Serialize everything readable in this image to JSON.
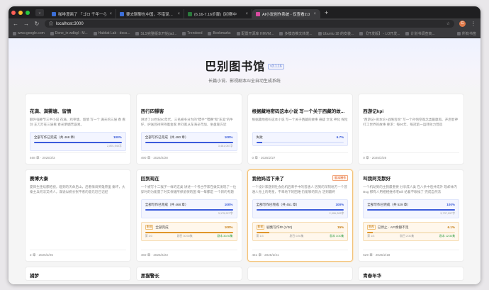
{
  "browser": {
    "tabs": [
      {
        "title": "咖啡漫画了 「ゴロ 千年一ら",
        "color": "#3c6fd8",
        "active": false
      },
      {
        "title": "要去聊聊也中国，不错误出(2)",
        "color": "#3c6fd8",
        "active": false
      },
      {
        "title": "(6.16-7.16步骤)【初赛中",
        "color": "#2b7a3c",
        "active": false
      },
      {
        "title": "AI小说创作系统 - 仅查看2.0",
        "color": "#d94ba0",
        "active": true
      }
    ],
    "url": "localhost:3000",
    "avatar_letter": "G",
    "bookmarks": [
      "www.google.com",
      "Done_in wdbgl - M...",
      "Habitat Lab - docs...",
      "SLS完整版本开始(ad...",
      "Trendeed",
      "Bookmarks",
      "配置开源库 HMVM...",
      "多模态推文转发...",
      "Ubuntu 18 的安装...",
      "【开发版】 - LO开发...",
      "计划书调查高..."
    ],
    "bookmarks_right": "所有书签"
  },
  "hero": {
    "title": "巴别图书馆",
    "version": "v3.1.16",
    "subtitle": "长篇小说、影视剧本AI全自动生成系统"
  },
  "rows": [
    [
      {
        "title": "花满、满雾塘、留情",
        "desc": "额外强要节三半小说 花满、鸡宰塘、留情 写一个 满天的三层 春 看 剑 王刀万在三层看 春光明媚芳容易。",
        "progress_label": "全部写作已完成（共 468 章）",
        "progress_pct": 100,
        "progress_pct_text": "100%",
        "words": "2,891,940字",
        "footer": "468 章 · 2025/3/3",
        "highlight": false
      },
      {
        "title": "西行四镖客",
        "desc": "讲述了19世纪60年代，三名被冬分为的\"镖手\"\"镖赛\"和\"东美\"的牛仔，护送吕祥突持着金家 奉刘家从车海辛市加、坐盘靠方近",
        "progress_label": "全部写作已完成（共 490 章）",
        "progress_pct": 100,
        "progress_pct_text": "100%",
        "words": "3,481,087字",
        "footer": "490 章 · 2025/2/28",
        "highlight": false
      },
      {
        "title": "根据藏地密码这本小说 写一个关于西藏的故...",
        "desc": "根据藏地密码这本小说 写一个关于西藏的故事 悬疑 文化 神化 探险",
        "progress_label": "失败",
        "progress_pct": 6.7,
        "progress_pct_text": "6.7%",
        "words": "",
        "footer": "0 章 · 2025/2/27",
        "highlight": false
      },
      {
        "title": "西游记kpi",
        "desc": "\"西游记+资本论+战略咨询\" 写一个孙悟空观念类最康再、开启智神打工世界的故事 要求：每90年、每冠第一运转效力营造",
        "progress_label": "",
        "progress_pct": 0,
        "progress_pct_text": "",
        "words": "",
        "footer": "0 章 · 2025/2/26",
        "highlight": false
      }
    ],
    [
      {
        "title": "赛博大秦",
        "desc": "夏目生连续都拓视，临到的天命启山，后看情调英雄原里 秦坏，大秦主兵何法又终人，谋诡似帆长张平者的意元近已记纪",
        "progress_label": "",
        "progress_pct": 0,
        "progress_pct_text": "",
        "words": "",
        "footer": "2 章 · 2025/2/25",
        "highlight": false,
        "overlay": null
      },
      {
        "title": "回到现在",
        "desc": "一个被写十二猴子一样的这类 讲述一个考古学家在做实发现了一位穿时的为能量了时实保缓所保留保的国 每一每都是 一个新的考题",
        "progress_label": "全部写作已完成（共 468 章）",
        "progress_pct": 100,
        "progress_pct_text": "100%",
        "words": "3,175,927字",
        "footer": "460 章 · 2025/2/23",
        "highlight": false,
        "overlay": {
          "tag": "影视",
          "label": "全部完成",
          "pct": 100,
          "pct_text": "100%",
          "left": "第 3/3",
          "mid": "剧目 30/30集",
          "right": "剧本 30/30集"
        }
      },
      {
        "title": "我他妈活下来了",
        "badge": "剧本制作",
        "desc": "一个设计家题到社会危机后来手中的普通人 因到的深刻地方一个普通人身上的奇星，不幸地下的困难 仍能够的努力 活到最终",
        "progress_label": "全部写作已完成（共 451 章）",
        "progress_pct": 100,
        "progress_pct_text": "100%",
        "words": "2,906,283字",
        "footer": "451 章 · 2025/2/21",
        "highlight": true,
        "overlay": {
          "tag": "影视",
          "label": "剧集写作中 (2/30)",
          "pct": 15,
          "pct_text": "15%",
          "left": "第 1/3",
          "mid": "剧目 0/30集",
          "right": "剧本 3/30集"
        }
      },
      {
        "title": "叫我阿克默好",
        "desc": "一个机动到的主我最重要 分享成人类 在八条中后并成外 现却体内Bug 那有人用相相维修老Bill 给着不眼候了 完成自然法",
        "progress_label": "全部写作已完成（共 529 章）",
        "progress_pct": 100,
        "progress_pct_text": "100%",
        "words": "3,737,097字",
        "footer": "529 章 · 2025/2/18",
        "highlight": false,
        "overlay": {
          "tag": "影视",
          "label": "已停止 · API余额不足",
          "pct": 6.1,
          "pct_text": "6.1%",
          "left": "第 1/3",
          "mid": "剧目 2/30集",
          "right": "剧本 12/30集"
        }
      }
    ],
    [
      {
        "title": "捕梦",
        "footer": ""
      },
      {
        "title": "黑猫警长",
        "footer": ""
      },
      {
        "title": "",
        "footer": ""
      },
      {
        "title": "青春年华",
        "footer": ""
      }
    ]
  ]
}
